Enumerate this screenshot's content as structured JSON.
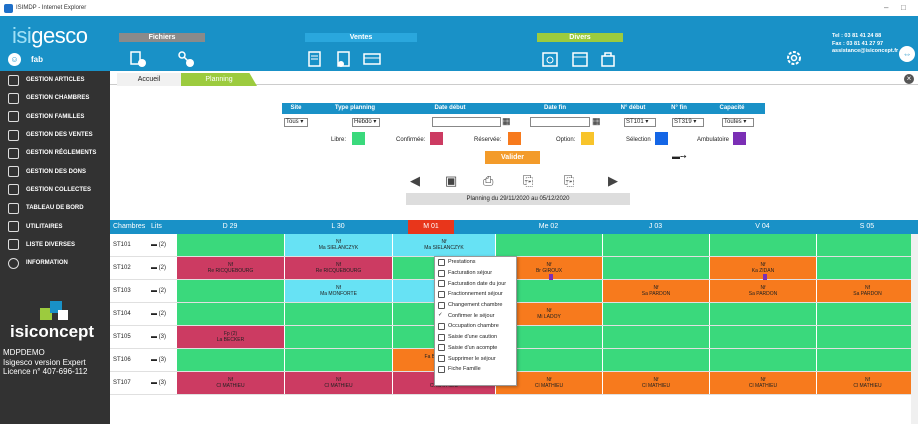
{
  "window": {
    "title": "ISIMDP - Internet Explorer"
  },
  "header": {
    "logo_a": "isi",
    "logo_b": "gesco",
    "user": "fab",
    "sections": {
      "fichiers": "Fichiers",
      "ventes": "Ventes",
      "divers": "Divers"
    },
    "contact": {
      "tel": "Tel : 03 81 41 24 88",
      "fax": "Fax : 03 81 41 27 97",
      "email": "assistance@isiconcept.fr"
    }
  },
  "sidebar": {
    "items": [
      "GESTION ARTICLES",
      "GESTION CHAMBRES",
      "GESTION FAMILLES",
      "GESTION DES VENTES",
      "GESTION RÉGLEMENTS",
      "GESTION DES DONS",
      "GESTION COLLECTES",
      "TABLEAU DE BORD",
      "UTILITAIRES",
      "LISTE DIVERSES",
      "INFORMATION"
    ],
    "brand": "isiconcept",
    "meta": [
      "MDPDEMO",
      "Isigesco version Expert",
      "Licence n° 407-696-112"
    ]
  },
  "tabs": [
    "Accueil",
    "Planning"
  ],
  "filters": {
    "headers": [
      "Site",
      "Type planning",
      "Date début",
      "Date fin",
      "N° début",
      "N° fin",
      "Capacité"
    ],
    "site": "Tous",
    "type": "Hebdo",
    "num_debut": "ST101",
    "num_fin": "ST319",
    "capacite": "Toutes",
    "legend": {
      "libre": "Libre:",
      "confirmee": "Confirmée:",
      "reservee": "Réservée:",
      "option": "Option:",
      "selection": "Sélection",
      "ambulatoire": "Ambulatoire"
    },
    "valider": "Valider"
  },
  "period": "Planning du 29/11/2020 au 05/12/2020",
  "grid": {
    "head_chambres": "Chambres",
    "head_lits": "Lits",
    "days": [
      "D 29",
      "L 30",
      "M 01",
      "Me 02",
      "J 03",
      "V 04",
      "S 05"
    ],
    "rows": [
      {
        "n": "ST101",
        "b": "(2)",
        "cells": [
          [
            "g",
            ""
          ],
          [
            "c",
            "Nf",
            "Ma SIELANCZYK"
          ],
          [
            "c",
            "Nf",
            "Ma SIELANCZYK"
          ],
          [
            "g",
            ""
          ],
          [
            "g",
            ""
          ],
          [
            "g",
            ""
          ],
          [
            "g",
            ""
          ]
        ]
      },
      {
        "n": "ST102",
        "b": "(2)",
        "cells": [
          [
            "r",
            "Nf",
            "Re RICQUEBOURG"
          ],
          [
            "r",
            "Nf",
            "Re RICQUEBOURG"
          ],
          [
            "g",
            ""
          ],
          [
            "o",
            "Nf",
            "Br GIROUX"
          ],
          [
            "g",
            ""
          ],
          [
            "o",
            "Nf",
            "Ka ZIDAN"
          ],
          [
            "g",
            ""
          ]
        ]
      },
      {
        "n": "ST103",
        "b": "(2)",
        "cells": [
          [
            "g",
            ""
          ],
          [
            "c",
            "Nf",
            "Ma MONFORTE"
          ],
          [
            "c",
            "",
            "Ma MO"
          ],
          [
            "g",
            ""
          ],
          [
            "o",
            "Nf",
            "Sa PARDON"
          ],
          [
            "o",
            "Nf",
            "Sa PARDON"
          ],
          [
            "o",
            "Nf",
            "Sa PARDON"
          ]
        ]
      },
      {
        "n": "ST104",
        "b": "(2)",
        "cells": [
          [
            "g",
            ""
          ],
          [
            "g",
            ""
          ],
          [
            "g",
            ""
          ],
          [
            "o",
            "Nf",
            "Mi LADOY"
          ],
          [
            "g",
            ""
          ],
          [
            "g",
            ""
          ],
          [
            "g",
            ""
          ]
        ]
      },
      {
        "n": "ST105",
        "b": "(3)",
        "cells": [
          [
            "r",
            "Fp (2)",
            "La BECKER"
          ],
          [
            "g",
            ""
          ],
          [
            "g",
            ""
          ],
          [
            "g",
            ""
          ],
          [
            "g",
            ""
          ],
          [
            "g",
            ""
          ],
          [
            "g",
            ""
          ]
        ]
      },
      {
        "n": "ST106",
        "b": "(3)",
        "cells": [
          [
            "g",
            ""
          ],
          [
            "g",
            ""
          ],
          [
            "o",
            "",
            "Fa BORZELLINO"
          ],
          [
            "g",
            ""
          ],
          [
            "g",
            ""
          ],
          [
            "g",
            ""
          ],
          [
            "g",
            ""
          ]
        ]
      },
      {
        "n": "ST107",
        "b": "(3)",
        "cells": [
          [
            "r",
            "Nf",
            "Cl MATHIEU"
          ],
          [
            "r",
            "Nf",
            "Cl MATHIEU"
          ],
          [
            "r",
            "Nf",
            "Cl MATHIEU"
          ],
          [
            "o",
            "Nf",
            "Cl MATHIEU"
          ],
          [
            "o",
            "Nf",
            "Cl MATHIEU"
          ],
          [
            "o",
            "Nf",
            "Cl MATHIEU"
          ],
          [
            "o",
            "Nf",
            "Cl MATHIEU"
          ]
        ]
      }
    ]
  },
  "context_menu": [
    "Prestations",
    "Facturation séjour",
    "Facturation date du jour",
    "Fractionnement séjour",
    "Changement chambre",
    "Confirmer le séjour",
    "Occupation chambre",
    "Saisie d'une caution",
    "Saisie d'un acompte",
    "Supprimer le séjour",
    "Fiche Famille"
  ],
  "colors": {
    "header": "#1991c7",
    "libre": "#3ad97c",
    "confirmee": "#cc3b62",
    "reservee": "#f77a1d",
    "option": "#f8c42b",
    "selection": "#1466e6",
    "ambulatoire": "#7b2fb5"
  }
}
